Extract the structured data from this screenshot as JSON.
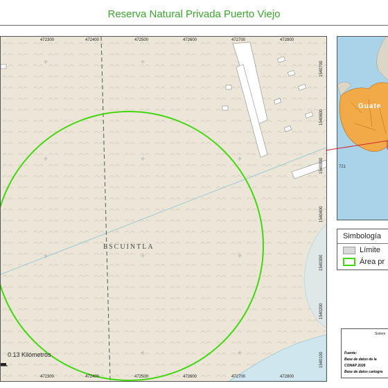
{
  "title": "Reserva Natural Privada Puerto Viejo",
  "map": {
    "place_label": "ESCUINTLA",
    "scale_label": "0.13 Kilómetros",
    "x_ticks": [
      "472300",
      "472400",
      "472500",
      "472600",
      "472700",
      "472800"
    ],
    "y_ticks": [
      "1540700",
      "1540600",
      "1540500",
      "1540400",
      "1540300",
      "1540200",
      "1540100"
    ],
    "colors": {
      "area": "#41d60c",
      "background": "#ece6d8",
      "river": "#9ec9d2"
    }
  },
  "inset": {
    "country_label": "Guate",
    "coast_label": "721",
    "colors": {
      "water": "#a9d3e8",
      "country": "#f2a948"
    }
  },
  "legend": {
    "title": "Simbología",
    "items": [
      {
        "label": "Límite",
        "color": "#d9d9d9"
      },
      {
        "label": "Área pr",
        "color": "#41d60c"
      }
    ]
  },
  "notes": {
    "header": "Sistem",
    "source_label": "Fuente:",
    "line1": "Base de datos de la",
    "line2": "CONAP 2026",
    "line3": "Base de datos cartogra"
  }
}
